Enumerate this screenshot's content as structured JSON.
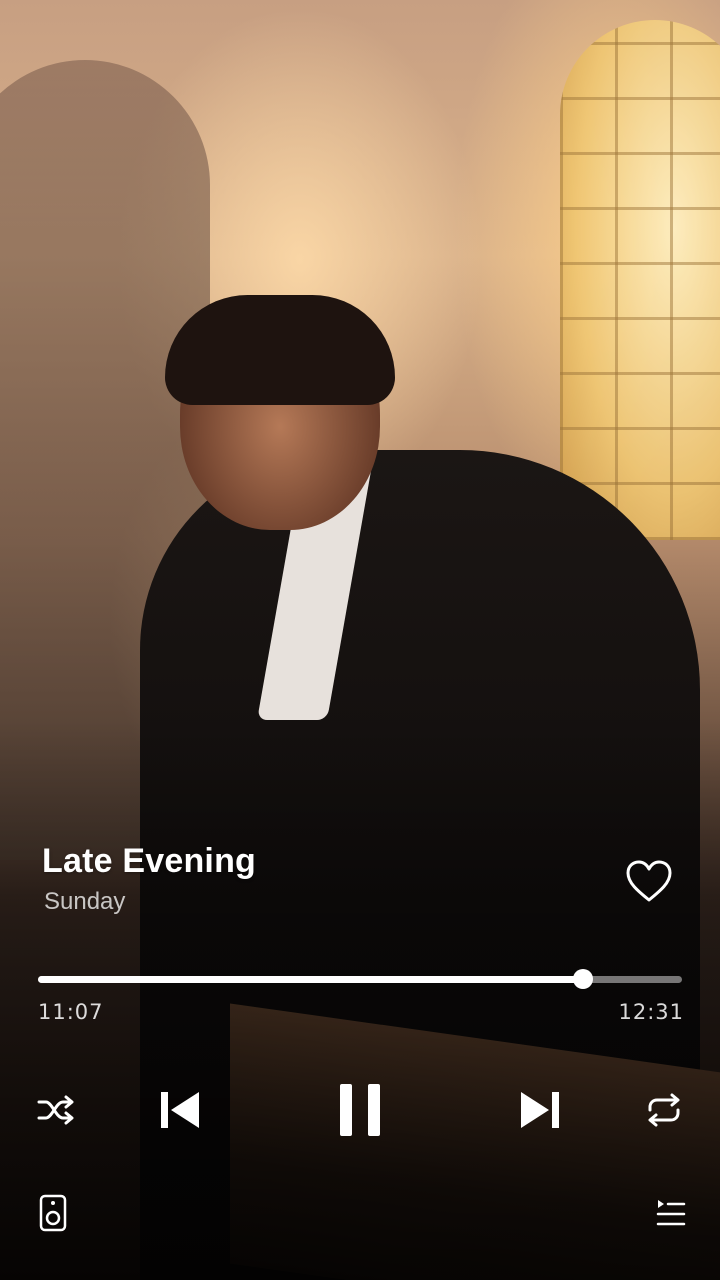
{
  "player": {
    "title": "Late Evening",
    "artist": "Sunday",
    "elapsed": "11:07",
    "duration": "12:31",
    "progress_percent": 84.7,
    "liked": false,
    "state": "playing"
  },
  "controls": {
    "shuffle_icon": "shuffle-icon",
    "previous_icon": "skip-previous-icon",
    "pause_icon": "pause-icon",
    "next_icon": "skip-next-icon",
    "repeat_icon": "repeat-icon",
    "speaker_icon": "speaker-device-icon",
    "queue_icon": "playlist-queue-icon"
  },
  "colors": {
    "foreground": "#ffffff",
    "progress_track": "rgba(255,255,255,0.45)"
  }
}
